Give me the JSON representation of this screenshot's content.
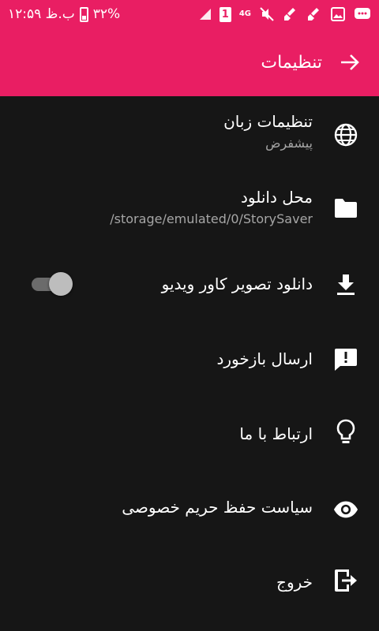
{
  "status_bar": {
    "time": "۱۲:۵۹ ب.ظ",
    "battery": "۳۲%",
    "sim": "1",
    "network": "4G"
  },
  "toolbar": {
    "title": "تنظیمات",
    "back_icon": "arrow-forward-icon"
  },
  "settings": [
    {
      "title": "تنظیمات زبان",
      "subtitle": "پیشفرض",
      "icon": "globe-icon"
    },
    {
      "title": "محل دانلود",
      "subtitle": "/storage/emulated/0/StorySaver",
      "icon": "folder-icon"
    },
    {
      "title": "دانلود تصویر کاور ویدیو",
      "icon": "download-icon",
      "toggle": false
    },
    {
      "title": "ارسال بازخورد",
      "icon": "feedback-icon"
    },
    {
      "title": "ارتباط با ما",
      "icon": "lightbulb-icon"
    },
    {
      "title": "سیاست حفظ حریم خصوصی",
      "icon": "eye-icon"
    },
    {
      "title": "خروج",
      "icon": "exit-icon"
    }
  ],
  "colors": {
    "accent": "#e91e63",
    "background": "#161616",
    "subtitle": "#a6a6a6"
  }
}
